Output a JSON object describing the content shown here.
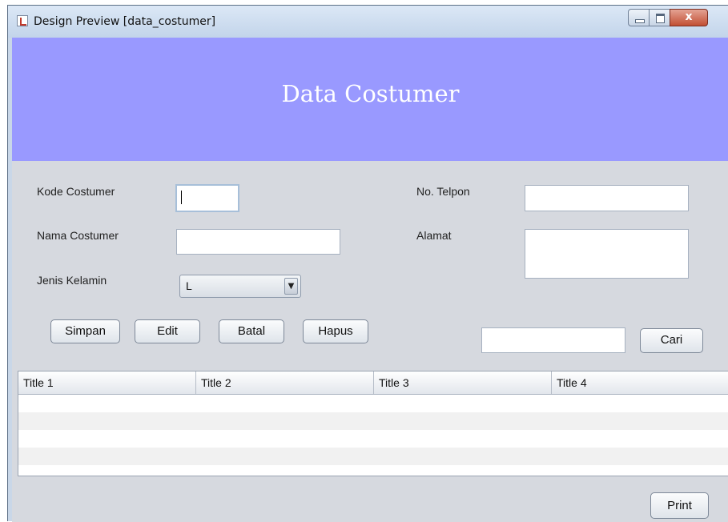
{
  "window": {
    "title": "Design Preview [data_costumer]",
    "close_glyph": "x"
  },
  "header": {
    "title": "Data Costumer",
    "background": "#9999ff"
  },
  "form": {
    "kode_label": "Kode Costumer",
    "kode_value": "",
    "nama_label": "Nama Costumer",
    "nama_value": "",
    "jenis_label": "Jenis Kelamin",
    "jenis_value": "L",
    "telpon_label": "No. Telpon",
    "telpon_value": "",
    "alamat_label": "Alamat",
    "alamat_value": ""
  },
  "actions": {
    "simpan": "Simpan",
    "edit": "Edit",
    "batal": "Batal",
    "hapus": "Hapus",
    "search_value": "",
    "cari": "Cari",
    "print": "Print"
  },
  "table": {
    "columns": [
      "Title 1",
      "Title 2",
      "Title 3",
      "Title 4"
    ]
  }
}
